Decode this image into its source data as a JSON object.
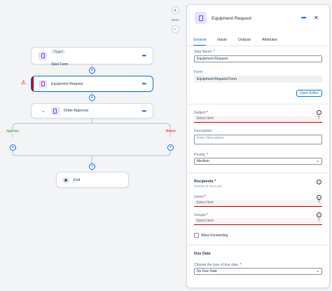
{
  "canvas": {
    "zoom": {
      "in_label": "+",
      "level": "100%",
      "out_label": "−"
    },
    "nodes": {
      "trigger": {
        "tag": "Trigger",
        "title": "Start Form"
      },
      "request": {
        "title": "Equipment Request"
      },
      "approval": {
        "title": "Order Approval"
      },
      "end": {
        "title": "End"
      }
    },
    "branches": {
      "approve": "Approve",
      "reject": "Reject"
    },
    "add_symbol": "+",
    "more_symbol": "•••",
    "warning_symbol": "⚠",
    "collapse_symbol": "⌄"
  },
  "panel": {
    "title": "Equipment Request",
    "more_symbol": "•••",
    "close_symbol": "✕",
    "tabs": [
      "General",
      "Inputs",
      "Outputs",
      "Attributes"
    ],
    "active_tab": "General",
    "step_name": {
      "label": "Step Name:",
      "required": "*",
      "value": "Equipment Request"
    },
    "form": {
      "label": "Form:",
      "value": "Equipment Request Form"
    },
    "open_editor": "Open Editor",
    "subject": {
      "label": "Subject:",
      "required": "*",
      "placeholder": "Select Item"
    },
    "description": {
      "label": "Description:",
      "placeholder": "Enter Description"
    },
    "priority": {
      "label": "Priority:",
      "required": "*",
      "value": "Medium"
    },
    "recipients": {
      "title": "Recipients",
      "required": "*",
      "hint": "Provide at least one"
    },
    "users": {
      "label": "Users:",
      "required": "*",
      "placeholder": "Select Item"
    },
    "groups": {
      "label": "Groups:",
      "required": "*",
      "placeholder": "Select Item"
    },
    "allow_forwarding": "Allow Forwarding",
    "due_date": {
      "title": "Due Date",
      "label": "Choose the type of due date:",
      "required": "*",
      "value": "No Due Date"
    },
    "info_symbol": "i",
    "text_icon": "T",
    "caret_symbol": "⌄"
  },
  "colors": {
    "accent": "#0a6ed1",
    "error": "#bb0000",
    "icon_bg": "#e8e1fb",
    "approve": "#256f3a",
    "reject": "#aa0808"
  },
  "icons": [
    "form-icon",
    "warning-icon",
    "more-icon",
    "plus-icon",
    "close-icon",
    "info-icon",
    "text-type-icon",
    "chevron-down-icon",
    "end-icon"
  ]
}
